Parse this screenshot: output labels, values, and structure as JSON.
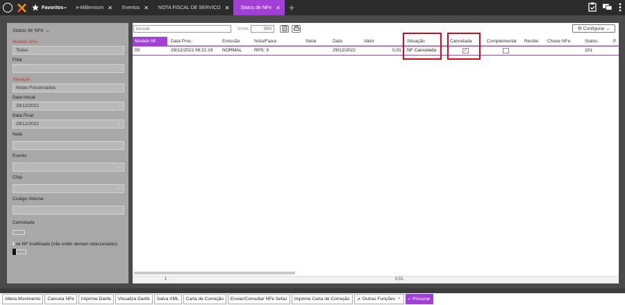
{
  "topbar": {
    "favorites_label": "Favoritos",
    "tabs": [
      {
        "label": "e-Millennium",
        "active": false
      },
      {
        "label": "Eventos",
        "active": false
      },
      {
        "label": "NOTA FISCAL DE SERVICO",
        "active": false
      },
      {
        "label": "Status de NFe",
        "active": true
      }
    ],
    "icons": [
      "back-icon",
      "logo-x-icon",
      "star-icon",
      "add-tab-icon",
      "clipboard-check-icon",
      "chat-icon",
      "more-vert-icon"
    ]
  },
  "sidebar": {
    "title": "Status de NFe",
    "fields": [
      {
        "label": "Modelo NFe",
        "value": "Todos",
        "required": true,
        "dropdown": false
      },
      {
        "label": "Filial",
        "value": "",
        "required": false,
        "dropdown": false
      },
      {
        "label": "Situação",
        "value": "Notas Processadas",
        "required": true,
        "dropdown": true
      },
      {
        "label": "Data Inicial",
        "value": "29/12/2022",
        "required": false,
        "dropdown": true
      },
      {
        "label": "Data Final",
        "value": "29/12/2022",
        "required": false,
        "dropdown": true
      },
      {
        "label": "Nota",
        "value": "",
        "required": false,
        "dropdown": false
      },
      {
        "label": "Evento",
        "value": "",
        "required": false,
        "dropdown": true
      },
      {
        "label": "Cfop",
        "value": "",
        "required": false,
        "dropdown": true
      },
      {
        "label": "Codigo Volume",
        "value": "",
        "required": false,
        "dropdown": false
      }
    ],
    "cancelada_label": "Cancelada",
    "inutilizada_label": "se NF Inutilizada (não exibir demais relacionadas)"
  },
  "toolbar": {
    "search_placeholder": "buscar",
    "limit_label": "limite:",
    "limit_value": "500",
    "config_label": "Configurar"
  },
  "grid": {
    "columns": [
      "Modelo Nf",
      "Data Proc.",
      "Emissão",
      "Nota/Faixa",
      "Série",
      "Data",
      "Valor",
      "Situação",
      "Cancelada",
      "Complementar",
      "Recibo",
      "Chave NFe",
      "Status",
      "P"
    ],
    "rows": [
      {
        "modelo_nf": "00",
        "data_proc": "29/12/2022 08:21:19",
        "emissao": "NORMAL",
        "nota_faixa": "RPS: 9",
        "serie": "",
        "data": "29/12/2022",
        "valor": "0,01",
        "situacao": "NF Cancelada",
        "cancelada": true,
        "complementar": false,
        "recibo": "",
        "chave_nfe": "",
        "status": "101"
      }
    ],
    "footer": {
      "count": "1",
      "total": "0,01"
    }
  },
  "bottom_buttons": [
    "Altera Movimento",
    "Cancela NFe",
    "Imprime Danfe",
    "Visualiza Danfe",
    "Salva XML",
    "Carta de Correção",
    "Enviar/Consultar NFe Sefaz",
    "Imprime Carta de Correção",
    "Outras Funções",
    "Procurar"
  ],
  "colors": {
    "accent": "#a23fd6",
    "highlight": "#e0001a",
    "required_label": "#c0392b"
  }
}
